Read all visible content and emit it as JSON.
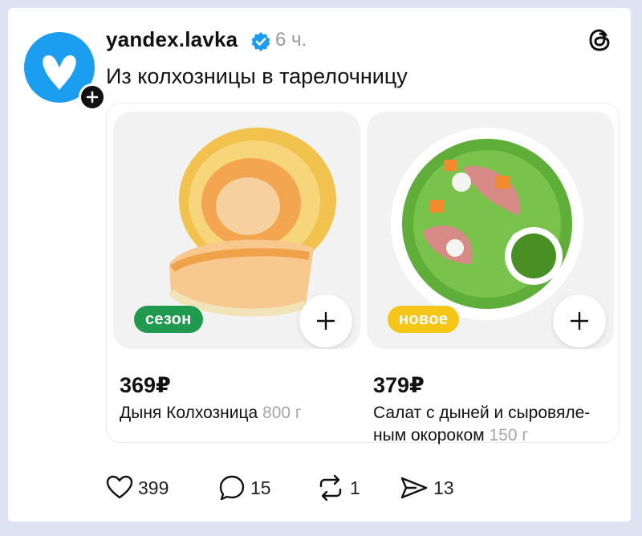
{
  "post": {
    "username": "yandex.lavka",
    "timestamp": "6 ч.",
    "text": "Из колхозницы в тарелочницу"
  },
  "products": [
    {
      "badge": "сезон",
      "badge_color": "#1f9a4e",
      "badge_text_color": "#ffffff",
      "price": "369₽",
      "name": "Дыня Колхозница",
      "weight": "800 г",
      "image_icon": "melon-image"
    },
    {
      "badge": "новое",
      "badge_color": "#f5c518",
      "badge_text_color": "#ffffff",
      "price": "379₽",
      "name": "Салат с дыней и сыровяле-ным окороком",
      "weight": "150 г",
      "image_icon": "salad-image"
    }
  ],
  "actions": {
    "likes": "399",
    "comments": "15",
    "reposts": "1",
    "shares": "13"
  },
  "colors": {
    "background": "#dde3f3",
    "avatar": "#1b9df0",
    "verified": "#1d9bf0"
  }
}
